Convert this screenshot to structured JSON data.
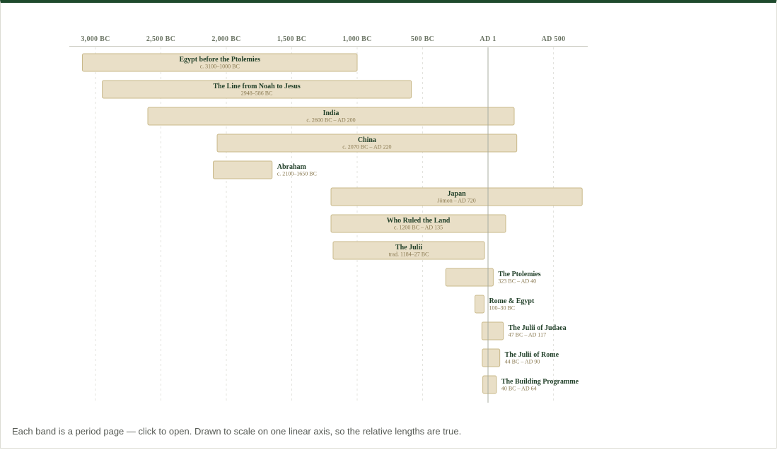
{
  "chart_data": {
    "type": "timeline",
    "axis_note": "years, negative = BC",
    "x_range": [
      -3200,
      750
    ],
    "ticks": [
      {
        "value": -3000,
        "label": "3,000 BC"
      },
      {
        "value": -2500,
        "label": "2,500 BC"
      },
      {
        "value": -2000,
        "label": "2,000 BC"
      },
      {
        "value": -1500,
        "label": "1,500 BC"
      },
      {
        "value": -1000,
        "label": "1,000 BC"
      },
      {
        "value": -500,
        "label": "500 BC"
      },
      {
        "value": 0,
        "label": "AD 1"
      },
      {
        "value": 500,
        "label": "AD 500"
      }
    ],
    "grid": true,
    "reference_line": 0,
    "bands": [
      {
        "title": "Egypt before the Ptolemies",
        "range": "c. 3100–1000 BC",
        "start": -3100,
        "end": -1000
      },
      {
        "title": "The Line from Noah to Jesus",
        "range": "2948–586 BC",
        "start": -2948,
        "end": -586
      },
      {
        "title": "India",
        "range": "c. 2600 BC – AD 200",
        "start": -2600,
        "end": 200
      },
      {
        "title": "China",
        "range": "c. 2070 BC – AD 220",
        "start": -2070,
        "end": 220
      },
      {
        "title": "Abraham",
        "range": "c. 2100–1650 BC",
        "start": -2100,
        "end": -1650
      },
      {
        "title": "Japan",
        "range": "Jōmon – AD 720",
        "start": -1200,
        "end": 720
      },
      {
        "title": "Who Ruled the Land",
        "range": "c. 1200 BC – AD 135",
        "start": -1200,
        "end": 135
      },
      {
        "title": "The Julii",
        "range": "trad. 1184–27 BC",
        "start": -1184,
        "end": -27
      },
      {
        "title": "The Ptolemies",
        "range": "323 BC – AD 40",
        "start": -323,
        "end": 40
      },
      {
        "title": "Rome & Egypt",
        "range": "100–30 BC",
        "start": -100,
        "end": -30
      },
      {
        "title": "The Julii of Judaea",
        "range": "47 BC – AD 117",
        "start": -47,
        "end": 117
      },
      {
        "title": "The Julii of Rome",
        "range": "44 BC – AD 90",
        "start": -44,
        "end": 90
      },
      {
        "title": "The Building Programme",
        "range": "40 BC – AD 64",
        "start": -40,
        "end": 64
      }
    ]
  },
  "caption": "Each band is a period page — click to open. Drawn to scale on one linear axis, so the relative lengths are true."
}
